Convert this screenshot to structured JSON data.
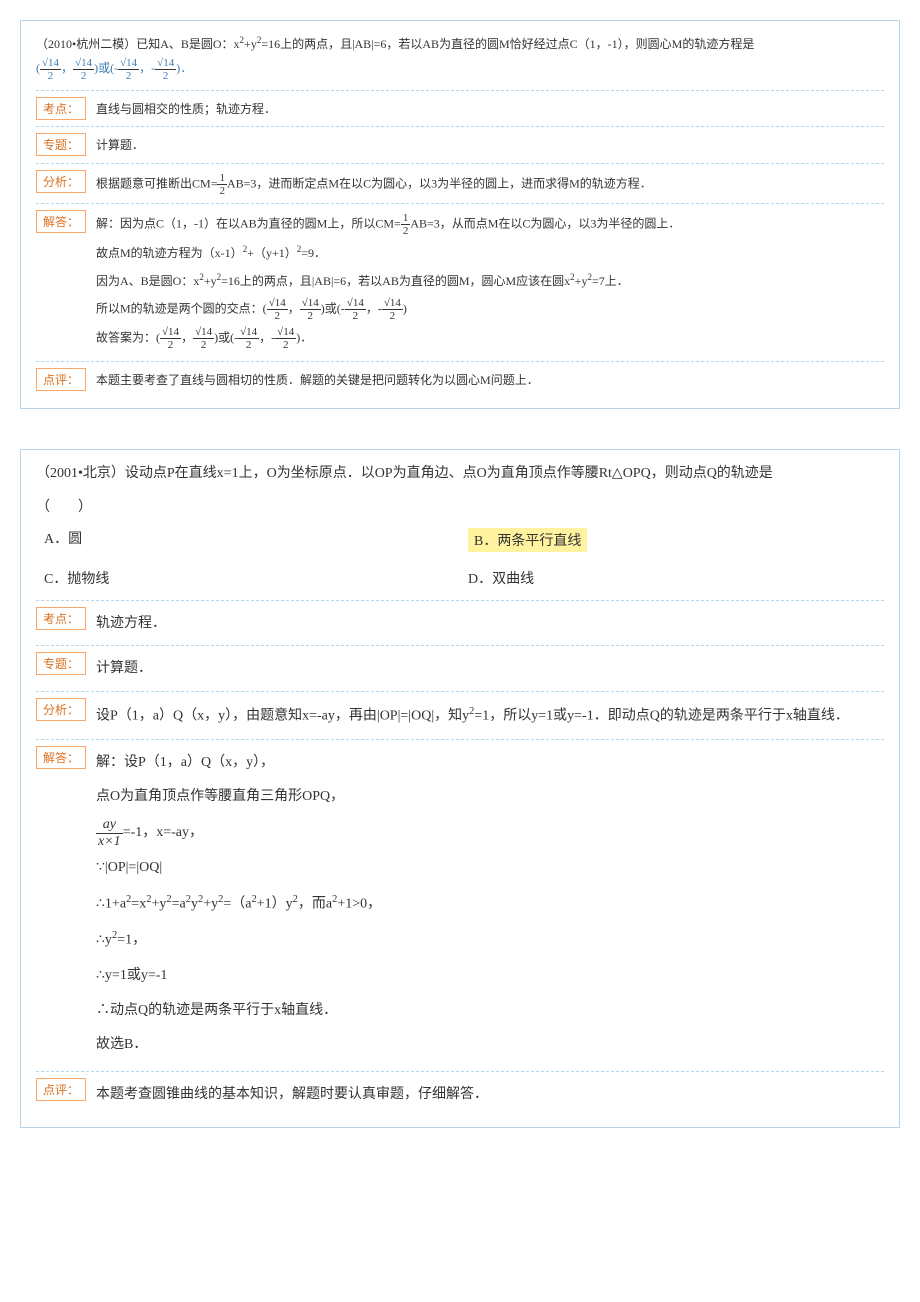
{
  "problem1": {
    "question_prefix": "（2010•杭州二模）已知A、B是圆O：x",
    "question_sup1": "2",
    "question_mid1": "+y",
    "question_sup2": "2",
    "question_mid2": "=16上的两点，且|AB|=6，若以AB为直径的圆M恰好经过点C（1，-1），则圆心M的轨迹方程是",
    "answer_text": "(√14/2，√14/2)或(-√14/2，-√14/2)",
    "period": "．",
    "kaodian_label": "考点：",
    "kaodian_content": "直线与圆相交的性质；轨迹方程．",
    "zhuanti_label": "专题：",
    "zhuanti_content": "计算题．",
    "fenxi_label": "分析：",
    "fenxi_content": "根据题意可推断出CM=½AB=3，进而断定点M在以C为圆心，以3为半径的圆上，进而求得M的轨迹方程．",
    "jieda_label": "解答：",
    "jieda_line1": "解：因为点C（1，-1）在以AB为直径的圆M上，所以CM=½AB=3，从而点M在以C为圆心，以3为半径的圆上．",
    "jieda_line2_prefix": "故点M的轨迹方程为（x-1）",
    "jieda_line2_sup1": "2",
    "jieda_line2_mid": "+（y+1）",
    "jieda_line2_sup2": "2",
    "jieda_line2_suffix": "=9．",
    "jieda_line3_prefix": "因为A、B是圆O：x",
    "jieda_line3_sup1": "2",
    "jieda_line3_mid1": "+y",
    "jieda_line3_sup2": "2",
    "jieda_line3_mid2": "=16上的两点，且|AB|=6，若以AB为直径的圆M，圆心M应该在圆x",
    "jieda_line3_sup3": "2",
    "jieda_line3_mid3": "+y",
    "jieda_line3_sup4": "2",
    "jieda_line3_suffix": "=7上．",
    "jieda_line4": "所以M的轨迹是两个圆的交点：(√14/2，√14/2)或(-√14/2，-√14/2)",
    "jieda_line5": "故答案为：(√14/2，√14/2)或(-√14/2，-√14/2)．",
    "dianping_label": "点评：",
    "dianping_content": "本题主要考查了直线与圆相切的性质．解题的关键是把问题转化为以圆心M问题上．"
  },
  "problem2": {
    "question": "（2001•北京）设动点P在直线x=1上，O为坐标原点．以OP为直角边、点O为直角顶点作等腰Rt△OPQ，则动点Q的轨迹是",
    "paren": "（　　）",
    "optA_label": "A．",
    "optA_text": "圆",
    "optB_label": "B．",
    "optB_text": "两条平行直线",
    "optC_label": "C．",
    "optC_text": "抛物线",
    "optD_label": "D．",
    "optD_text": "双曲线",
    "kaodian_label": "考点：",
    "kaodian_content": "轨迹方程．",
    "zhuanti_label": "专题：",
    "zhuanti_content": "计算题．",
    "fenxi_label": "分析：",
    "fenxi_prefix": "设P（1，a）Q（x，y），由题意知x=-ay，再由|OP|=|OQ|，知y",
    "fenxi_sup": "2",
    "fenxi_suffix": "=1，所以y=1或y=-1．即动点Q的轨迹是两条平行于x轴直线．",
    "jieda_label": "解答：",
    "jieda_line1": "解：设P（1，a）Q（x，y），",
    "jieda_line2": "点O为直角顶点作等腰直角三角形OPQ，",
    "jieda_line3_frac_num": "ay",
    "jieda_line3_frac_den": "x×1",
    "jieda_line3_suffix": "=-1，x=-ay，",
    "jieda_line4": "∵|OP|=|OQ|",
    "jieda_line5_prefix": "∴1+a",
    "jieda_line5_s1": "2",
    "jieda_line5_m1": "=x",
    "jieda_line5_s2": "2",
    "jieda_line5_m2": "+y",
    "jieda_line5_s3": "2",
    "jieda_line5_m3": "=a",
    "jieda_line5_s4": "2",
    "jieda_line5_m4": "y",
    "jieda_line5_s5": "2",
    "jieda_line5_m5": "+y",
    "jieda_line5_s6": "2",
    "jieda_line5_m6": "=（a",
    "jieda_line5_s7": "2",
    "jieda_line5_m7": "+1）y",
    "jieda_line5_s8": "2",
    "jieda_line5_m8": "，而a",
    "jieda_line5_s9": "2",
    "jieda_line5_suffix": "+1>0，",
    "jieda_line6_prefix": "∴y",
    "jieda_line6_sup": "2",
    "jieda_line6_suffix": "=1，",
    "jieda_line7": "∴y=1或y=-1",
    "jieda_line8": "∴动点Q的轨迹是两条平行于x轴直线．",
    "jieda_line9": "故选B．",
    "dianping_label": "点评：",
    "dianping_content": "本题考查圆锥曲线的基本知识，解题时要认真审题，仔细解答．"
  }
}
